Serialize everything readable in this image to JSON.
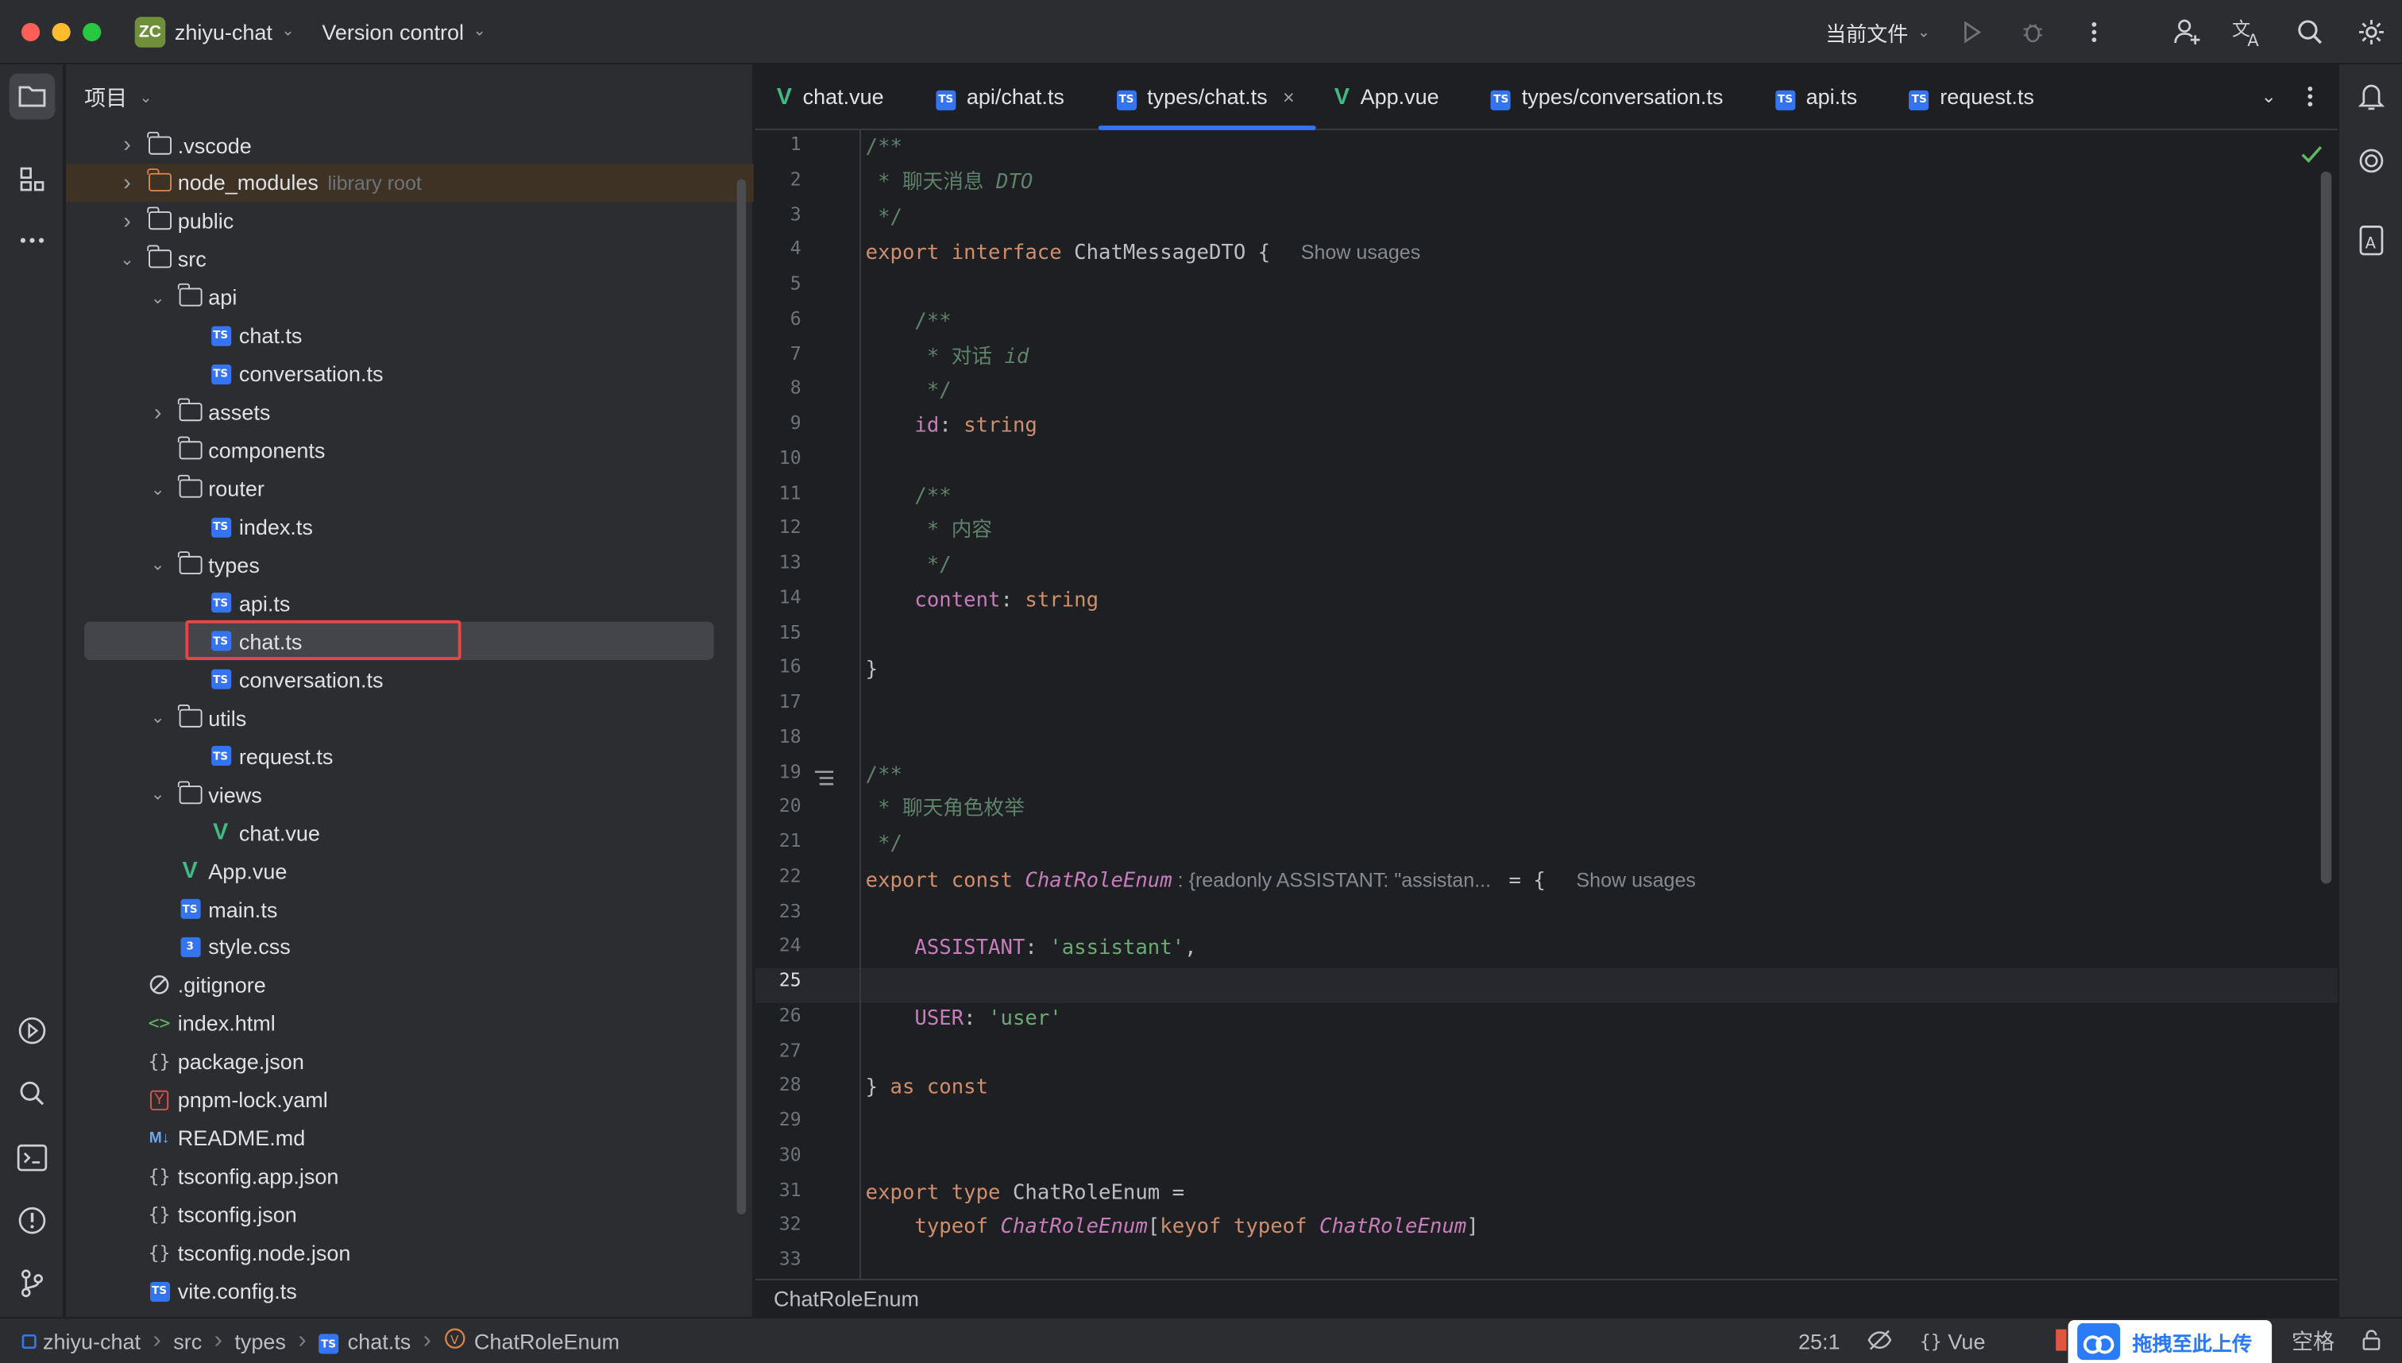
{
  "titlebar": {
    "project_initials": "ZC",
    "project_name": "zhiyu-chat",
    "version_control": "Version control",
    "run_config": "当前文件"
  },
  "project_panel": {
    "title": "项目",
    "tree": [
      {
        "label": ".vscode",
        "type": "folder",
        "depth": 1,
        "expanded": false
      },
      {
        "label": "node_modules",
        "hint": "library root",
        "type": "folder-lib",
        "depth": 1,
        "expanded": false
      },
      {
        "label": "public",
        "type": "folder",
        "depth": 1,
        "expanded": false
      },
      {
        "label": "src",
        "type": "folder",
        "depth": 1,
        "expanded": true
      },
      {
        "label": "api",
        "type": "folder",
        "depth": 2,
        "expanded": true
      },
      {
        "label": "chat.ts",
        "type": "ts",
        "depth": 3
      },
      {
        "label": "conversation.ts",
        "type": "ts",
        "depth": 3
      },
      {
        "label": "assets",
        "type": "folder",
        "depth": 2,
        "expanded": false
      },
      {
        "label": "components",
        "type": "folder",
        "depth": 2,
        "leaf": true
      },
      {
        "label": "router",
        "type": "folder",
        "depth": 2,
        "expanded": true
      },
      {
        "label": "index.ts",
        "type": "ts",
        "depth": 3
      },
      {
        "label": "types",
        "type": "folder",
        "depth": 2,
        "expanded": true
      },
      {
        "label": "api.ts",
        "type": "ts",
        "depth": 3
      },
      {
        "label": "chat.ts",
        "type": "ts",
        "depth": 3,
        "selected": true
      },
      {
        "label": "conversation.ts",
        "type": "ts",
        "depth": 3
      },
      {
        "label": "utils",
        "type": "folder",
        "depth": 2,
        "expanded": true
      },
      {
        "label": "request.ts",
        "type": "ts",
        "depth": 3
      },
      {
        "label": "views",
        "type": "folder",
        "depth": 2,
        "expanded": true
      },
      {
        "label": "chat.vue",
        "type": "vue",
        "depth": 3
      },
      {
        "label": "App.vue",
        "type": "vue",
        "depth": 2
      },
      {
        "label": "main.ts",
        "type": "ts",
        "depth": 2
      },
      {
        "label": "style.css",
        "type": "css",
        "depth": 2
      },
      {
        "label": ".gitignore",
        "type": "ignore",
        "depth": 1
      },
      {
        "label": "index.html",
        "type": "html",
        "depth": 1
      },
      {
        "label": "package.json",
        "type": "json",
        "depth": 1
      },
      {
        "label": "pnpm-lock.yaml",
        "type": "yaml",
        "depth": 1
      },
      {
        "label": "README.md",
        "type": "md",
        "depth": 1
      },
      {
        "label": "tsconfig.app.json",
        "type": "json",
        "depth": 1
      },
      {
        "label": "tsconfig.json",
        "type": "json",
        "depth": 1
      },
      {
        "label": "tsconfig.node.json",
        "type": "json",
        "depth": 1
      },
      {
        "label": "vite.config.ts",
        "type": "ts",
        "depth": 1
      }
    ]
  },
  "editor": {
    "tabs": [
      {
        "label": "chat.vue",
        "type": "vue"
      },
      {
        "label": "api/chat.ts",
        "type": "ts"
      },
      {
        "label": "types/chat.ts",
        "type": "ts",
        "active": true
      },
      {
        "label": "App.vue",
        "type": "vue"
      },
      {
        "label": "types/conversation.ts",
        "type": "ts"
      },
      {
        "label": "api.ts",
        "type": "ts"
      },
      {
        "label": "request.ts",
        "type": "ts"
      }
    ],
    "current_line": 25,
    "line_count": 33,
    "code": [
      [
        [
          "c-doc",
          "/**"
        ]
      ],
      [
        [
          "c-doc",
          " * 聊天消息 "
        ],
        [
          "c-docit",
          "DTO"
        ]
      ],
      [
        [
          "c-doc",
          " */"
        ]
      ],
      [
        [
          "c-kw",
          "export interface "
        ],
        [
          "c-ty",
          "ChatMessageDTO { "
        ],
        [
          "c-usage",
          "Show usages"
        ]
      ],
      [],
      [
        [
          "c-doc",
          "    /**"
        ]
      ],
      [
        [
          "c-doc",
          "     * 对话 "
        ],
        [
          "c-docit",
          "id"
        ]
      ],
      [
        [
          "c-doc",
          "     */"
        ]
      ],
      [
        [
          "c-prop",
          "    id"
        ],
        [
          "c-txt",
          ": "
        ],
        [
          "c-kw",
          "string"
        ]
      ],
      [],
      [
        [
          "c-doc",
          "    /**"
        ]
      ],
      [
        [
          "c-doc",
          "     * 内容"
        ]
      ],
      [
        [
          "c-doc",
          "     */"
        ]
      ],
      [
        [
          "c-prop",
          "    content"
        ],
        [
          "c-txt",
          ": "
        ],
        [
          "c-kw",
          "string"
        ]
      ],
      [],
      [
        [
          "c-txt",
          "}"
        ]
      ],
      [],
      [],
      [
        [
          "c-doc",
          "/**"
        ]
      ],
      [
        [
          "c-doc",
          " * 聊天角色枚举"
        ]
      ],
      [
        [
          "c-doc",
          " */"
        ]
      ],
      [
        [
          "c-kw",
          "export const "
        ],
        [
          "c-it",
          "ChatRoleEnum"
        ],
        [
          "c-inlay",
          " : {readonly ASSISTANT: \"assistan... "
        ],
        [
          "c-txt",
          " = { "
        ],
        [
          "c-usage",
          "Show usages"
        ]
      ],
      [],
      [
        [
          "c-prop",
          "    ASSISTANT"
        ],
        [
          "c-txt",
          ": "
        ],
        [
          "c-str",
          "'assistant'"
        ],
        [
          "c-txt",
          ","
        ]
      ],
      [],
      [
        [
          "c-prop",
          "    USER"
        ],
        [
          "c-txt",
          ": "
        ],
        [
          "c-str",
          "'user'"
        ]
      ],
      [],
      [
        [
          "c-txt",
          "} "
        ],
        [
          "c-kw",
          "as const"
        ]
      ],
      [],
      [],
      [
        [
          "c-kw",
          "export type "
        ],
        [
          "c-ty",
          "ChatRoleEnum ="
        ]
      ],
      [
        [
          "c-kw",
          "    typeof "
        ],
        [
          "c-it",
          "ChatRoleEnum"
        ],
        [
          "c-txt",
          "["
        ],
        [
          "c-kw",
          "keyof typeof "
        ],
        [
          "c-it",
          "ChatRoleEnum"
        ],
        [
          "c-txt",
          "]"
        ]
      ],
      []
    ],
    "breadcrumb": "ChatRoleEnum"
  },
  "statusbar": {
    "path": [
      "zhiyu-chat",
      "src",
      "types",
      "chat.ts",
      "ChatRoleEnum"
    ],
    "cursor": "25:1",
    "language": "Vue",
    "indent": "空格",
    "upload_label": "拖拽至此上传"
  },
  "colors": {
    "accent": "#3574f0",
    "selection_box": "#e84545",
    "vue_green": "#42b883"
  }
}
